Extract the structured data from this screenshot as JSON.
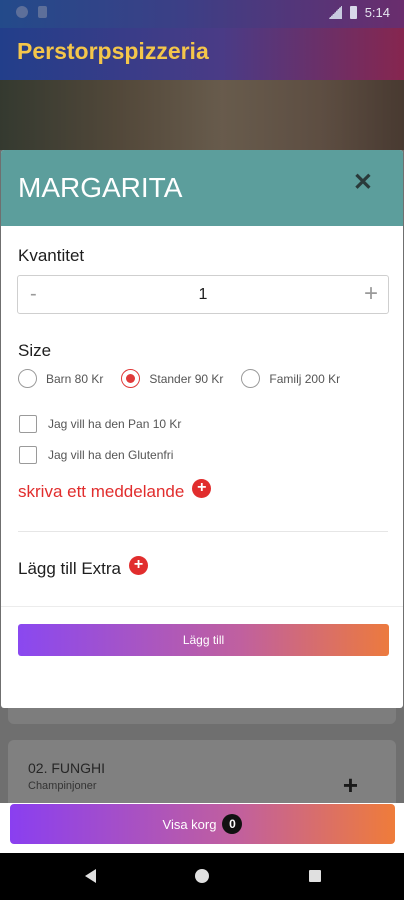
{
  "status_bar": {
    "time": "5:14"
  },
  "header": {
    "title": "Perstorpspizzeria"
  },
  "modal": {
    "title": "MARGARITA",
    "close_icon": "close-icon",
    "quantity_label": "Kvantitet",
    "quantity": {
      "minus": "-",
      "value": "1",
      "plus": "+"
    },
    "size_label": "Size",
    "sizes": [
      {
        "label": "Barn 80 Kr",
        "selected": false
      },
      {
        "label": "Stander 90 Kr",
        "selected": true
      },
      {
        "label": "Familj 200 Kr",
        "selected": false
      }
    ],
    "options": [
      {
        "label": "Jag vill ha den Pan 10 Kr",
        "checked": false
      },
      {
        "label": "Jag vill ha den Glutenfri",
        "checked": false
      }
    ],
    "message_label": "skriva ett meddelande",
    "extra_label": "Lägg till Extra",
    "add_button": "Lägg till"
  },
  "background_list": {
    "item": {
      "name": "02. FUNGHI",
      "description": "Champinjoner",
      "add_icon": "add-cart-icon"
    }
  },
  "cart": {
    "label": "Visa korg",
    "count": "0"
  },
  "colors": {
    "accent_red": "#e12d2d",
    "modal_header": "#5c9e9c",
    "title_yellow": "#f4c64a",
    "gradient_start": "#8a48f0",
    "gradient_end": "#ec7a3e"
  }
}
